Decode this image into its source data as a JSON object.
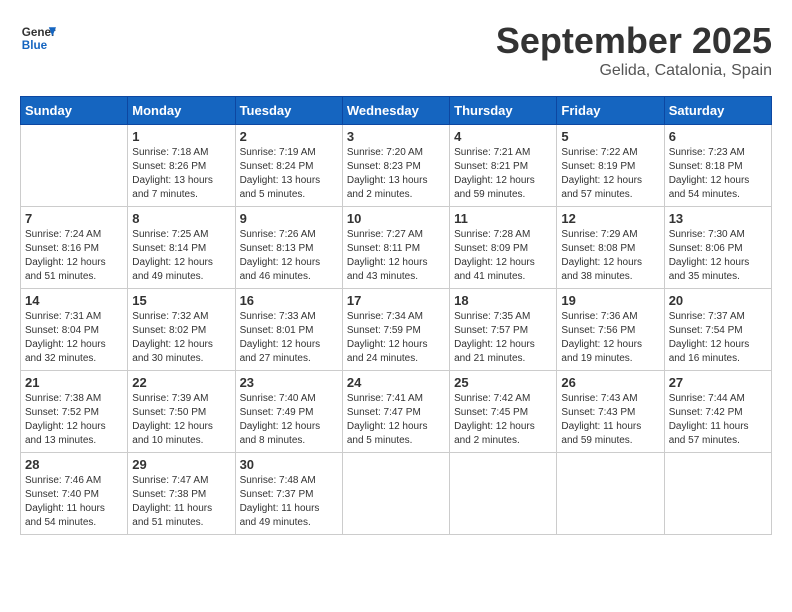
{
  "header": {
    "logo_general": "General",
    "logo_blue": "Blue",
    "month_title": "September 2025",
    "location": "Gelida, Catalonia, Spain"
  },
  "weekdays": [
    "Sunday",
    "Monday",
    "Tuesday",
    "Wednesday",
    "Thursday",
    "Friday",
    "Saturday"
  ],
  "weeks": [
    [
      {
        "day": "",
        "info": ""
      },
      {
        "day": "1",
        "info": "Sunrise: 7:18 AM\nSunset: 8:26 PM\nDaylight: 13 hours\nand 7 minutes."
      },
      {
        "day": "2",
        "info": "Sunrise: 7:19 AM\nSunset: 8:24 PM\nDaylight: 13 hours\nand 5 minutes."
      },
      {
        "day": "3",
        "info": "Sunrise: 7:20 AM\nSunset: 8:23 PM\nDaylight: 13 hours\nand 2 minutes."
      },
      {
        "day": "4",
        "info": "Sunrise: 7:21 AM\nSunset: 8:21 PM\nDaylight: 12 hours\nand 59 minutes."
      },
      {
        "day": "5",
        "info": "Sunrise: 7:22 AM\nSunset: 8:19 PM\nDaylight: 12 hours\nand 57 minutes."
      },
      {
        "day": "6",
        "info": "Sunrise: 7:23 AM\nSunset: 8:18 PM\nDaylight: 12 hours\nand 54 minutes."
      }
    ],
    [
      {
        "day": "7",
        "info": "Sunrise: 7:24 AM\nSunset: 8:16 PM\nDaylight: 12 hours\nand 51 minutes."
      },
      {
        "day": "8",
        "info": "Sunrise: 7:25 AM\nSunset: 8:14 PM\nDaylight: 12 hours\nand 49 minutes."
      },
      {
        "day": "9",
        "info": "Sunrise: 7:26 AM\nSunset: 8:13 PM\nDaylight: 12 hours\nand 46 minutes."
      },
      {
        "day": "10",
        "info": "Sunrise: 7:27 AM\nSunset: 8:11 PM\nDaylight: 12 hours\nand 43 minutes."
      },
      {
        "day": "11",
        "info": "Sunrise: 7:28 AM\nSunset: 8:09 PM\nDaylight: 12 hours\nand 41 minutes."
      },
      {
        "day": "12",
        "info": "Sunrise: 7:29 AM\nSunset: 8:08 PM\nDaylight: 12 hours\nand 38 minutes."
      },
      {
        "day": "13",
        "info": "Sunrise: 7:30 AM\nSunset: 8:06 PM\nDaylight: 12 hours\nand 35 minutes."
      }
    ],
    [
      {
        "day": "14",
        "info": "Sunrise: 7:31 AM\nSunset: 8:04 PM\nDaylight: 12 hours\nand 32 minutes."
      },
      {
        "day": "15",
        "info": "Sunrise: 7:32 AM\nSunset: 8:02 PM\nDaylight: 12 hours\nand 30 minutes."
      },
      {
        "day": "16",
        "info": "Sunrise: 7:33 AM\nSunset: 8:01 PM\nDaylight: 12 hours\nand 27 minutes."
      },
      {
        "day": "17",
        "info": "Sunrise: 7:34 AM\nSunset: 7:59 PM\nDaylight: 12 hours\nand 24 minutes."
      },
      {
        "day": "18",
        "info": "Sunrise: 7:35 AM\nSunset: 7:57 PM\nDaylight: 12 hours\nand 21 minutes."
      },
      {
        "day": "19",
        "info": "Sunrise: 7:36 AM\nSunset: 7:56 PM\nDaylight: 12 hours\nand 19 minutes."
      },
      {
        "day": "20",
        "info": "Sunrise: 7:37 AM\nSunset: 7:54 PM\nDaylight: 12 hours\nand 16 minutes."
      }
    ],
    [
      {
        "day": "21",
        "info": "Sunrise: 7:38 AM\nSunset: 7:52 PM\nDaylight: 12 hours\nand 13 minutes."
      },
      {
        "day": "22",
        "info": "Sunrise: 7:39 AM\nSunset: 7:50 PM\nDaylight: 12 hours\nand 10 minutes."
      },
      {
        "day": "23",
        "info": "Sunrise: 7:40 AM\nSunset: 7:49 PM\nDaylight: 12 hours\nand 8 minutes."
      },
      {
        "day": "24",
        "info": "Sunrise: 7:41 AM\nSunset: 7:47 PM\nDaylight: 12 hours\nand 5 minutes."
      },
      {
        "day": "25",
        "info": "Sunrise: 7:42 AM\nSunset: 7:45 PM\nDaylight: 12 hours\nand 2 minutes."
      },
      {
        "day": "26",
        "info": "Sunrise: 7:43 AM\nSunset: 7:43 PM\nDaylight: 11 hours\nand 59 minutes."
      },
      {
        "day": "27",
        "info": "Sunrise: 7:44 AM\nSunset: 7:42 PM\nDaylight: 11 hours\nand 57 minutes."
      }
    ],
    [
      {
        "day": "28",
        "info": "Sunrise: 7:46 AM\nSunset: 7:40 PM\nDaylight: 11 hours\nand 54 minutes."
      },
      {
        "day": "29",
        "info": "Sunrise: 7:47 AM\nSunset: 7:38 PM\nDaylight: 11 hours\nand 51 minutes."
      },
      {
        "day": "30",
        "info": "Sunrise: 7:48 AM\nSunset: 7:37 PM\nDaylight: 11 hours\nand 49 minutes."
      },
      {
        "day": "",
        "info": ""
      },
      {
        "day": "",
        "info": ""
      },
      {
        "day": "",
        "info": ""
      },
      {
        "day": "",
        "info": ""
      }
    ]
  ]
}
